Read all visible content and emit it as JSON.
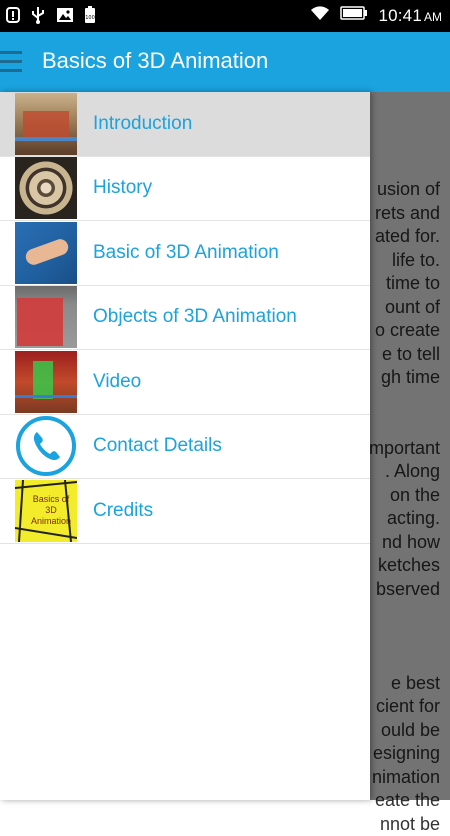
{
  "status_bar": {
    "time": "10:41",
    "ampm": "AM",
    "battery_text": "100",
    "icons": [
      "alert-icon",
      "usb-icon",
      "image-icon",
      "battery-icon",
      "wifi-icon",
      "battery-icon"
    ]
  },
  "app_bar": {
    "title": "Basics of 3D Animation",
    "color": "#1aa3de"
  },
  "drawer": {
    "items": [
      {
        "label": "Introduction",
        "selected": true
      },
      {
        "label": "History"
      },
      {
        "label": "Basic of 3D Animation"
      },
      {
        "label": "Objects of 3D Animation"
      },
      {
        "label": "Video"
      },
      {
        "label": "Contact Details"
      },
      {
        "label": "Credits"
      }
    ],
    "credits_thumb_text_1": "Basics of",
    "credits_thumb_text_2": "3D Animation"
  },
  "background_text": {
    "lines": [
      "usion of",
      "rets and",
      "ated for.",
      "life to.",
      "time to",
      "ount of",
      "o create",
      "e to tell",
      "gh time",
      "",
      "",
      "mportant",
      ". Along",
      "on the",
      "acting.",
      "nd how",
      "ketches",
      "bserved",
      "",
      "",
      "",
      "e best",
      "cient for",
      "ould be",
      "esigning",
      "nimation",
      "eate the",
      "nnot be"
    ]
  }
}
